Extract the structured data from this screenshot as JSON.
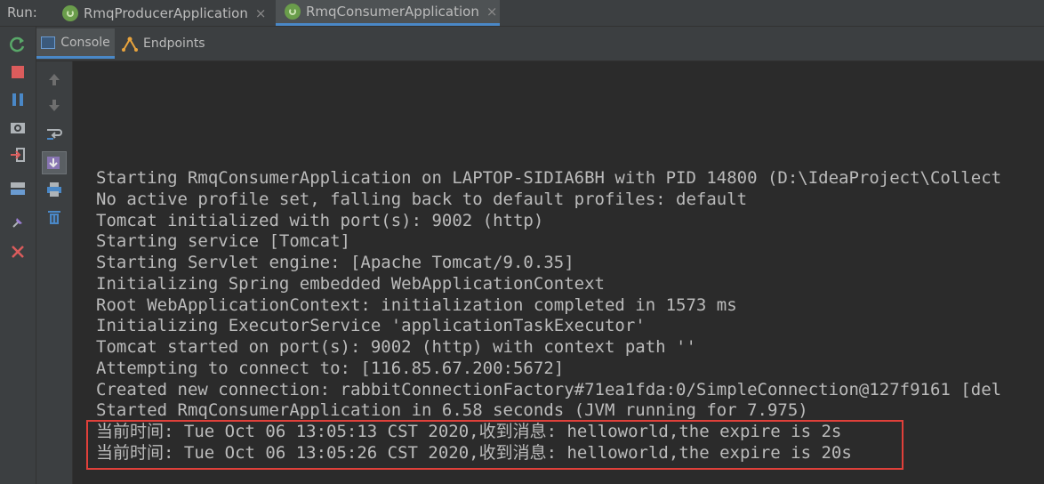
{
  "runbar": {
    "label": "Run:",
    "tabs": [
      {
        "label": "RmqProducerApplication",
        "close": "×"
      },
      {
        "label": "RmqConsumerApplication",
        "close": "×"
      }
    ]
  },
  "toolbar": {
    "console_label": "Console",
    "endpoints_label": "Endpoints"
  },
  "console": {
    "lines": [
      "Starting RmqConsumerApplication on LAPTOP-SIDIA6BH with PID 14800 (D:\\IdeaProject\\Collect",
      "No active profile set, falling back to default profiles: default",
      "Tomcat initialized with port(s): 9002 (http)",
      "Starting service [Tomcat]",
      "Starting Servlet engine: [Apache Tomcat/9.0.35]",
      "Initializing Spring embedded WebApplicationContext",
      "Root WebApplicationContext: initialization completed in 1573 ms",
      "Initializing ExecutorService 'applicationTaskExecutor'",
      "Tomcat started on port(s): 9002 (http) with context path ''",
      "Attempting to connect to: [116.85.67.200:5672]",
      "Created new connection: rabbitConnectionFactory#71ea1fda:0/SimpleConnection@127f9161 [del",
      "Started RmqConsumerApplication in 6.58 seconds (JVM running for 7.975)",
      "当前时间: Tue Oct 06 13:05:13 CST 2020,收到消息: helloworld,the expire is 2s",
      "当前时间: Tue Oct 06 13:05:26 CST 2020,收到消息: helloworld,the expire is 20s"
    ]
  },
  "colors": {
    "background": "#2b2b2b",
    "panel": "#3c3f41",
    "text": "#bbbbbb",
    "accent": "#4a88c7",
    "highlight_border": "#e0403a"
  }
}
